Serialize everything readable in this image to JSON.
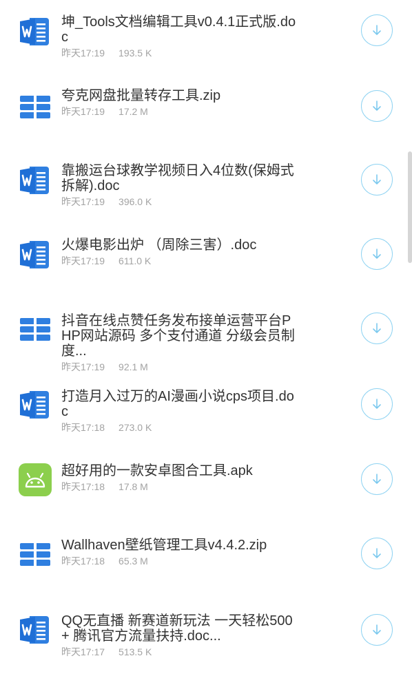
{
  "files": [
    {
      "icon": "word-doc-icon",
      "name": "坤_Tools文档编辑工具v0.4.1正式版.doc",
      "time": "昨天17:19",
      "size": "193.5 K"
    },
    {
      "icon": "zip-archive-icon",
      "name": "夸克网盘批量转存工具.zip",
      "time": "昨天17:19",
      "size": "17.2 M"
    },
    {
      "icon": "word-doc-icon",
      "name": "靠搬运台球教学视频日入4位数(保姆式拆解).doc",
      "time": "昨天17:19",
      "size": "396.0 K"
    },
    {
      "icon": "word-doc-icon",
      "name": "火爆电影出炉 （周除三害）.doc",
      "time": "昨天17:19",
      "size": "611.0 K"
    },
    {
      "icon": "zip-archive-icon",
      "name": "抖音在线点赞任务发布接单运营平台PHP网站源码 多个支付通道 分级会员制度...",
      "time": "昨天17:19",
      "size": "92.1 M"
    },
    {
      "icon": "word-doc-icon",
      "name": "打造月入过万的AI漫画小说cps项目.doc",
      "time": "昨天17:18",
      "size": "273.0 K"
    },
    {
      "icon": "android-apk-icon",
      "name": "超好用的一款安卓图合工具.apk",
      "time": "昨天17:18",
      "size": "17.8 M"
    },
    {
      "icon": "zip-archive-icon",
      "name": "Wallhaven壁纸管理工具v4.4.2.zip",
      "time": "昨天17:18",
      "size": "65.3 M"
    },
    {
      "icon": "word-doc-icon",
      "name": "QQ无直播 新赛道新玩法 一天轻松500+ 腾讯官方流量扶持.doc...",
      "time": "昨天17:17",
      "size": "513.5 K"
    }
  ],
  "colors": {
    "doc_blue": "#2f7fe0",
    "zip_blue": "#2f7fe0",
    "apk_green": "#8ccf4d",
    "download_ring": "#8fd3f2",
    "download_arrow": "#7cc9ee",
    "meta_gray": "#a3a3a3",
    "name_text": "#333333"
  }
}
